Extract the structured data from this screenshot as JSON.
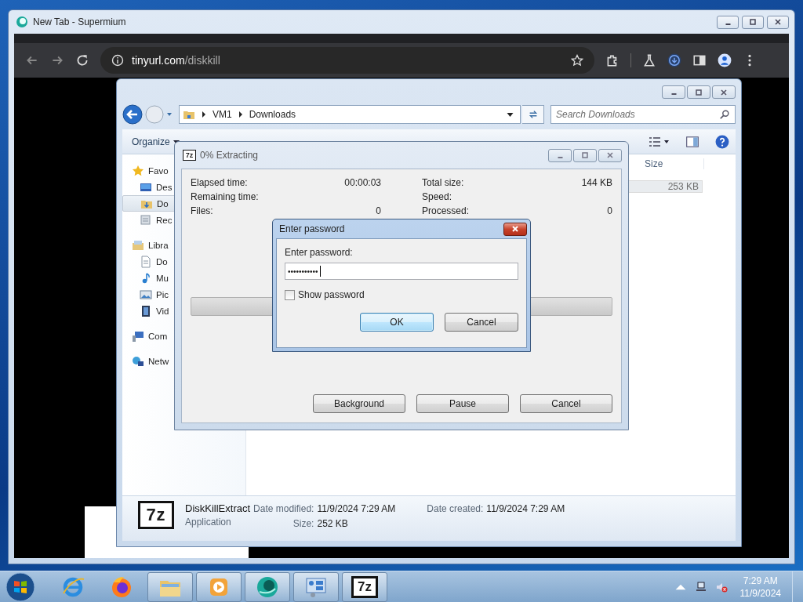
{
  "browser": {
    "title": "New Tab - Supermium",
    "url_host": "tinyurl.com",
    "url_path": "/diskkill"
  },
  "explorer": {
    "breadcrumb": [
      "VM1",
      "Downloads"
    ],
    "search": {
      "placeholder": "Search Downloads"
    },
    "toolbar": [
      {
        "label": "Organize",
        "dropdown": true
      }
    ],
    "nav": [
      {
        "label": "Favo",
        "kind": "star",
        "selected": false,
        "children": [
          {
            "label": "Des",
            "kind": "desktop",
            "selected": false
          },
          {
            "label": "Do",
            "kind": "downloads",
            "selected": true
          },
          {
            "label": "Rec",
            "kind": "recent",
            "selected": false
          }
        ]
      },
      {
        "label": "Libra",
        "kind": "library",
        "selected": false,
        "children": [
          {
            "label": "Do",
            "kind": "document",
            "selected": false
          },
          {
            "label": "Mu",
            "kind": "music",
            "selected": false
          },
          {
            "label": "Pic",
            "kind": "pictures",
            "selected": false
          },
          {
            "label": "Vid",
            "kind": "videos",
            "selected": false
          }
        ]
      },
      {
        "label": "Com",
        "kind": "computer",
        "selected": false
      },
      {
        "label": "Netw",
        "kind": "network",
        "selected": false
      }
    ],
    "columns": [
      "Size"
    ],
    "rows": [
      {
        "size": "253 KB",
        "selected": true
      }
    ],
    "details": {
      "icon_text": "7z",
      "name": "DiskKillExtract",
      "type": "Application",
      "fields": [
        {
          "label": "Date modified:",
          "value": "11/9/2024 7:29 AM"
        },
        {
          "label": "Size:",
          "value": "252 KB"
        },
        {
          "label": "Date created:",
          "value": "11/9/2024 7:29 AM"
        }
      ]
    }
  },
  "extract_dialog": {
    "icon_text": "7z",
    "title": "0% Extracting",
    "stat_columns": [
      [
        {
          "label": "Elapsed time:",
          "value": "00:00:03"
        },
        {
          "label": "Remaining time:"
        },
        {
          "label": "Files:",
          "value": "0"
        }
      ],
      [
        {
          "label": "Total size:",
          "value": "144 KB"
        },
        {
          "label": "Speed:"
        },
        {
          "label": "Processed:",
          "value": "0"
        }
      ]
    ],
    "progress": {
      "level": 0
    },
    "buttons": [
      "Background",
      "Pause",
      "Cancel"
    ]
  },
  "password_dialog": {
    "title": "Enter password",
    "label": "Enter password:",
    "value": "•••••••••••",
    "show_password": {
      "label": "Show password",
      "checked": false
    },
    "buttons": [
      {
        "label": "OK",
        "default": true
      },
      {
        "label": "Cancel",
        "default": false
      }
    ]
  },
  "taskbar": {
    "apps": [
      {
        "kind": "ie",
        "open": false
      },
      {
        "kind": "firefox",
        "open": false
      },
      {
        "kind": "explorer",
        "open": true
      },
      {
        "kind": "media",
        "open": true
      },
      {
        "kind": "supermium",
        "open": true
      },
      {
        "kind": "control",
        "open": true
      },
      {
        "kind": "sevenzip",
        "open": true,
        "label": "7z"
      }
    ],
    "time": "7:29 AM",
    "date": "11/9/2024"
  }
}
